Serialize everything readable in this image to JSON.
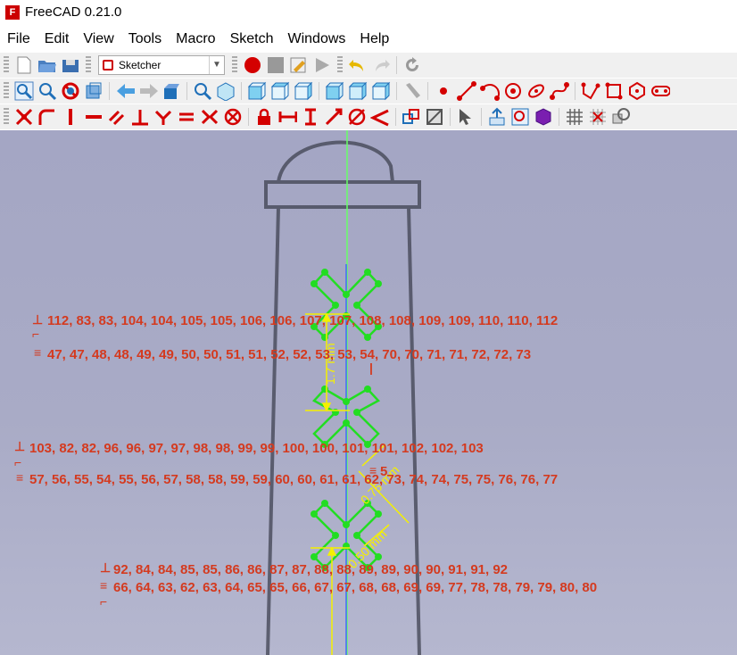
{
  "window": {
    "title": "FreeCAD 0.21.0",
    "logo_text": "F"
  },
  "menu": [
    "File",
    "Edit",
    "View",
    "Tools",
    "Macro",
    "Sketch",
    "Windows",
    "Help"
  ],
  "workbench": {
    "selected": "Sketcher"
  },
  "viewport": {
    "dimension_labels": [
      "1.7 mm",
      "0.75 mm",
      "0.50 mm"
    ],
    "constraint_groups": [
      {
        "perpendicular": "112, 83, 83, 104, 104, 105, 105, 106, 106, 107, 107, 108, 108, 109, 109, 110, 110, 112",
        "equal": "47, 47, 48, 48, 49, 49, 50, 50, 51, 51, 52, 52, 53, 53, 54, 70, 70, 71, 71, 72, 72, 73"
      },
      {
        "perpendicular": "103, 82, 82, 96, 96, 97, 97, 98, 98, 99, 99, 100, 100, 101, 101, 102, 102, 103",
        "equal": "57, 56, 55, 54, 55, 56, 57, 58, 58, 59, 59, 60, 60, 61, 61, 62, 73, 74, 74, 75, 75, 76, 76, 77"
      },
      {
        "perpendicular": "92, 84, 84, 85, 85, 86, 86, 87, 87, 88, 88, 89, 89, 90, 90, 91, 91, 92",
        "equal": "66, 64, 63, 62, 63, 64, 65, 65, 66, 67, 67, 68, 68, 69, 69, 77, 78, 78, 79, 79, 80, 80"
      }
    ],
    "extra_label": "5",
    "colors": {
      "geometry": "#22dd22",
      "constraint": "#d43a1f",
      "dimension": "#f5f000",
      "axis_v": "#66ff66",
      "axis_h": "#4466ff"
    }
  }
}
